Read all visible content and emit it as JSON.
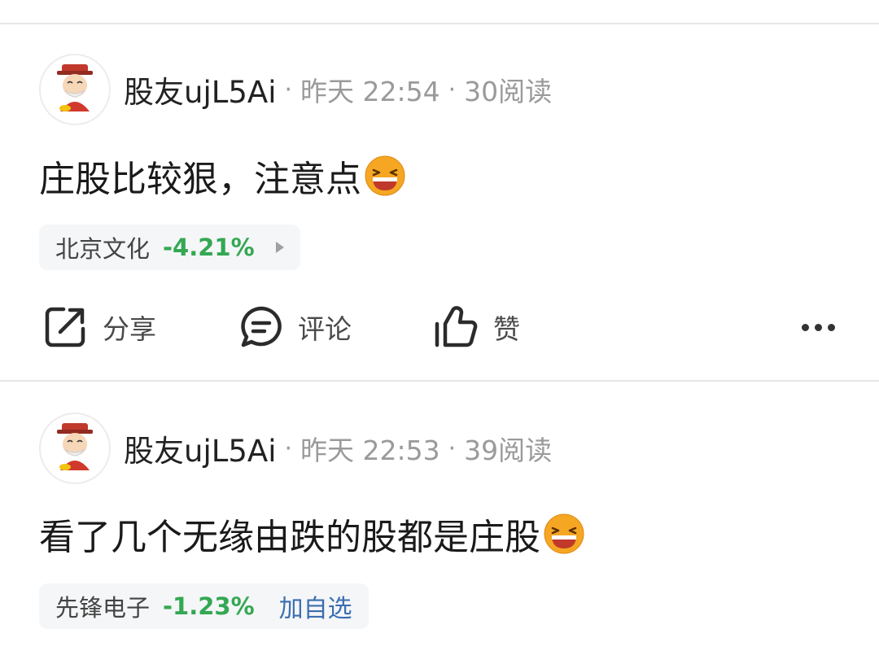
{
  "posts": [
    {
      "username": "股友ujL5Ai",
      "separator": "·",
      "time": "昨天 22:54",
      "reads": "30阅读",
      "content": "庄股比较狠，注意点",
      "stock": {
        "name": "北京文化",
        "change": "-4.21%",
        "change_color": "#34a853"
      },
      "actions": {
        "share": "分享",
        "comment": "评论",
        "like": "赞"
      }
    },
    {
      "username": "股友ujL5Ai",
      "separator": "·",
      "time": "昨天 22:53",
      "reads": "39阅读",
      "content": "看了几个无缘由跌的股都是庄股",
      "stock": {
        "name": "先锋电子",
        "change": "-1.23%",
        "change_color": "#34a853",
        "add_label": "加自选"
      }
    }
  ],
  "icons": [
    "avatar",
    "laughing-emoji-icon",
    "play-arrow-icon",
    "share-icon",
    "comment-icon",
    "thumbs-up-icon",
    "more-icon"
  ]
}
